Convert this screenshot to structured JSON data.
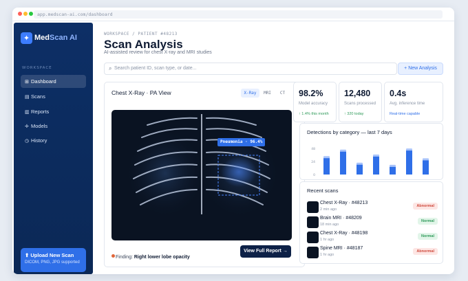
{
  "browser": {
    "url": "app.medscan-ai.com/dashboard"
  },
  "brand": {
    "name_part1": "Med",
    "name_part2": "Scan AI",
    "logo_glyph": "✦"
  },
  "sidebar": {
    "section_label": "WORKSPACE",
    "items": [
      {
        "label": "Dashboard",
        "icon": "grid-icon",
        "glyph": "⊞",
        "active": true
      },
      {
        "label": "Scans",
        "icon": "document-icon",
        "glyph": "▤",
        "active": false
      },
      {
        "label": "Reports",
        "icon": "bar-chart-icon",
        "glyph": "▥",
        "active": false
      },
      {
        "label": "Models",
        "icon": "nodes-icon",
        "glyph": "✛",
        "active": false
      },
      {
        "label": "History",
        "icon": "clock-icon",
        "glyph": "◷",
        "active": false
      }
    ],
    "upload": {
      "title": "⬆ Upload New Scan",
      "formats": "DICOM, PNG, JPG supported"
    }
  },
  "header": {
    "breadcrumb": "WORKSPACE / PATIENT #48213",
    "title": "Scan Analysis",
    "subtitle": "AI-assisted review for chest X-ray and MRI studies"
  },
  "search": {
    "placeholder": "Search patient ID, scan type, or date..."
  },
  "actions": {
    "new_analysis": "+ New Analysis"
  },
  "scan": {
    "title": "Chest X-Ray · PA View",
    "modes": [
      {
        "label": "X-Ray",
        "active": true
      },
      {
        "label": "MRI",
        "active": false
      },
      {
        "label": "CT",
        "active": false
      }
    ],
    "detection_label": "Pneumonia · 96.4%",
    "finding_prefix": "Finding:",
    "finding_value": "Right lower lobe opacity",
    "report_button": "View Full Report →"
  },
  "stats": [
    {
      "value": "98.2%",
      "label": "Model accuracy",
      "delta": "↑ 1.4% this month",
      "delta_color": "#2f9a5a"
    },
    {
      "value": "12,480",
      "label": "Scans processed",
      "delta": "↑ 320 today",
      "delta_color": "#2f9a5a"
    },
    {
      "value": "0.4s",
      "label": "Avg. inference time",
      "delta": "Real-time capable",
      "delta_color": "#2f6fe8"
    }
  ],
  "chart_data": {
    "type": "bar",
    "title": "Detections by category — last 7 days",
    "yticks": [
      "48",
      "24",
      "0"
    ],
    "ylim": [
      0,
      48
    ],
    "values": [
      30,
      42,
      18,
      33,
      14,
      44,
      26
    ],
    "color": "#2f6fe8",
    "grid": false
  },
  "recent": {
    "title": "Recent scans",
    "rows": [
      {
        "name": "Chest X-Ray · #48213",
        "time": "2 min ago",
        "status": "Abnormal",
        "kind": "abnormal"
      },
      {
        "name": "Brain MRI · #48209",
        "time": "18 min ago",
        "status": "Normal",
        "kind": "normal"
      },
      {
        "name": "Chest X-Ray · #48198",
        "time": "1 hr ago",
        "status": "Normal",
        "kind": "normal"
      },
      {
        "name": "Spine MRI · #48187",
        "time": "1 hr ago",
        "status": "Abnormal",
        "kind": "abnormal"
      }
    ]
  },
  "colors": {
    "sidebar": "#0d2f66",
    "accent": "#2f6fe8",
    "dark_button": "#0d2147",
    "detection": "#4a86ff"
  }
}
